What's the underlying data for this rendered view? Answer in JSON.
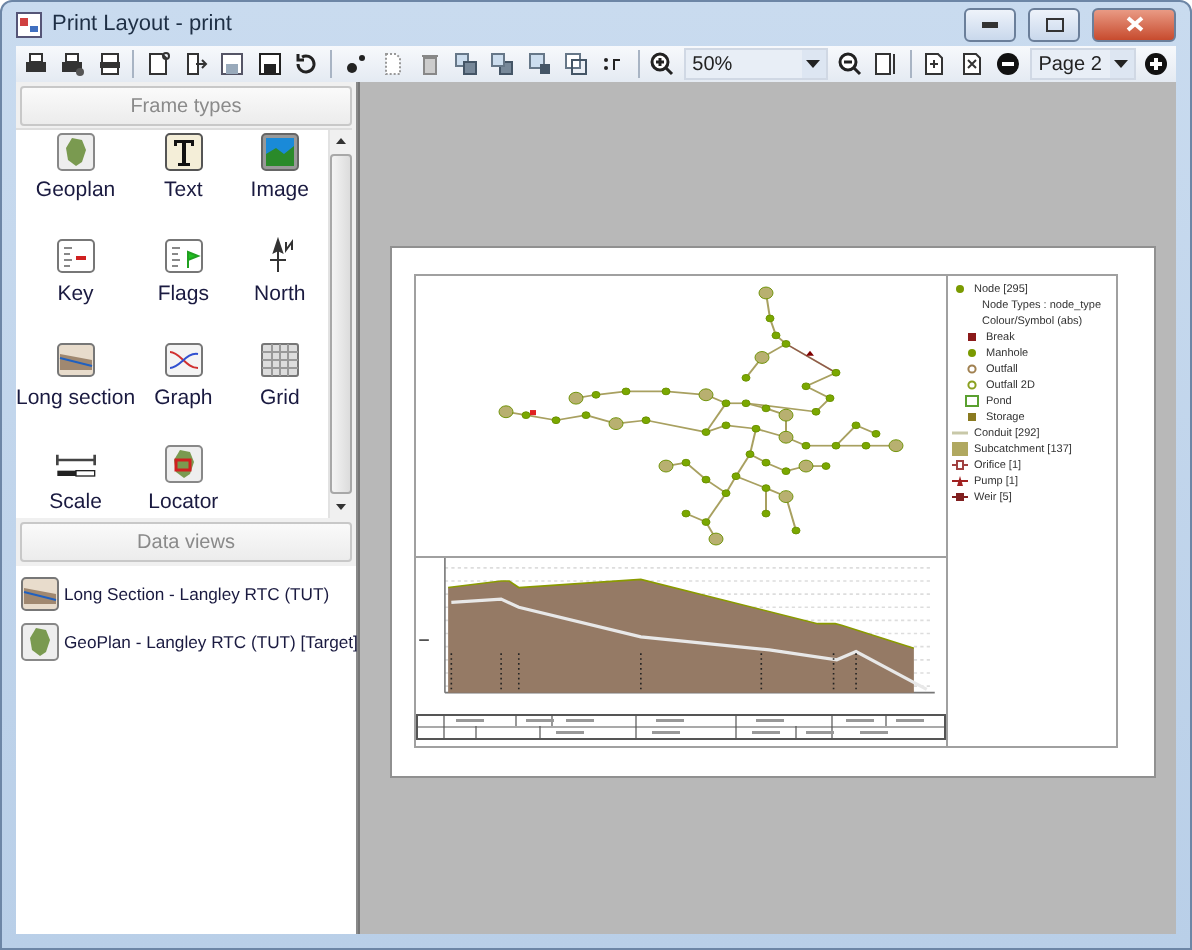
{
  "window": {
    "title": "Print Layout - print"
  },
  "toolbar": {
    "zoom": "50%",
    "page": "Page 2"
  },
  "frame_types": {
    "title": "Frame types",
    "items": [
      {
        "label": "Geoplan",
        "kind": "geoplan"
      },
      {
        "label": "Text",
        "kind": "text"
      },
      {
        "label": "Image",
        "kind": "image"
      },
      {
        "label": "Key",
        "kind": "key"
      },
      {
        "label": "Flags",
        "kind": "flags"
      },
      {
        "label": "North",
        "kind": "north"
      },
      {
        "label": "Long section",
        "kind": "longsection"
      },
      {
        "label": "Graph",
        "kind": "graph"
      },
      {
        "label": "Grid",
        "kind": "grid"
      },
      {
        "label": "Scale",
        "kind": "scale"
      },
      {
        "label": "Locator",
        "kind": "locator"
      }
    ]
  },
  "data_views": {
    "title": "Data views",
    "items": [
      {
        "label": "Long Section - Langley RTC (TUT)",
        "kind": "longsection"
      },
      {
        "label": "GeoPlan - Langley RTC (TUT) [Target]",
        "kind": "geoplan"
      }
    ]
  },
  "legend": [
    {
      "label": "Node [295]",
      "kind": "dot",
      "color": "#7a9a00",
      "children": [
        {
          "label": "Node Types : node_type"
        },
        {
          "label": "Colour/Symbol (abs)"
        },
        {
          "label": "Break",
          "kind": "square",
          "color": "#8b1a1a"
        },
        {
          "label": "Manhole",
          "kind": "dot",
          "color": "#7a9a00"
        },
        {
          "label": "Outfall",
          "kind": "ring",
          "color": "#a08050"
        },
        {
          "label": "Outfall 2D",
          "kind": "ring",
          "color": "#8aa020"
        },
        {
          "label": "Pond",
          "kind": "pond",
          "color": "#5aa030"
        },
        {
          "label": "Storage",
          "kind": "square",
          "color": "#8a7a20"
        }
      ]
    },
    {
      "label": "Conduit [292]",
      "kind": "line",
      "color": "#c8c8a8"
    },
    {
      "label": "Subcatchment [137]",
      "kind": "fill",
      "color": "#b0a860"
    },
    {
      "label": "Orifice [1]",
      "kind": "orifice",
      "color": "#a04040"
    },
    {
      "label": "Pump [1]",
      "kind": "pump",
      "color": "#a02020"
    },
    {
      "label": "Weir [5]",
      "kind": "weir",
      "color": "#802020"
    }
  ]
}
